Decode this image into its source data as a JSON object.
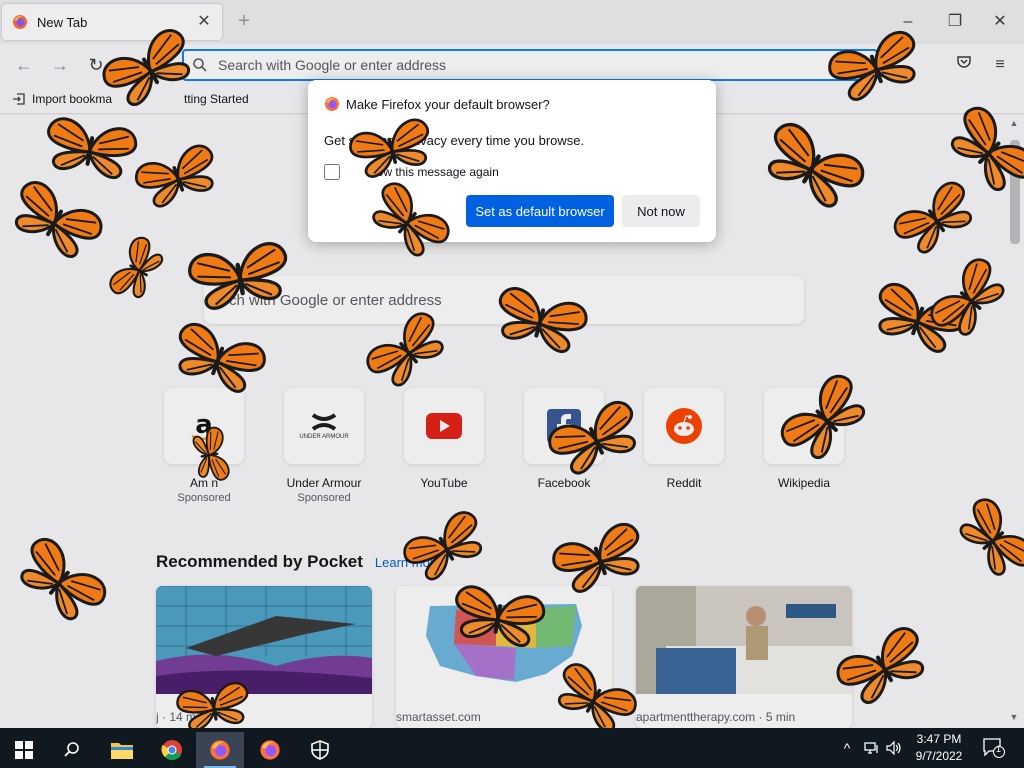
{
  "browser": {
    "tab_title": "New Tab",
    "tab_close": "✕",
    "new_tab": "+",
    "url_placeholder": "Search with Google or enter address",
    "bookmarks": [
      {
        "label": "Import bookma"
      },
      {
        "label": "tting Started"
      }
    ]
  },
  "content": {
    "search_placeholder": "rch with Google or enter address",
    "shortcuts": [
      {
        "label": "Am  n",
        "sponsored": "Sponsored"
      },
      {
        "label": "Under Armour",
        "sponsored": "Sponsored"
      },
      {
        "label": "YouTube"
      },
      {
        "label": "Facebook"
      },
      {
        "label": "Reddit"
      },
      {
        "label": "Wikipedia"
      }
    ],
    "pocket": {
      "heading": "Recommended by Pocket",
      "learn_more": "Learn more",
      "cards": [
        {
          "source": "j      · 14 min"
        },
        {
          "source": "smartasset.com"
        },
        {
          "source": "apartmenttherapy.com · 5 min"
        }
      ]
    },
    "ua_logo_text": "UNDER ARMOUR"
  },
  "modal": {
    "title": "Make Firefox your default browser?",
    "body": "Get  spee          and privacy every time you browse.",
    "checkbox_label": "how this message again",
    "primary_button": "Set as default browser",
    "secondary_button": "Not now"
  },
  "taskbar": {
    "time": "3:47 PM",
    "date": "9/7/2022",
    "notification_count": "1"
  },
  "colors": {
    "accent": "#0061e0",
    "focus_ring": "#0a84ff",
    "butterfly_orange": "#f07b14",
    "taskbar_bg": "#101820"
  }
}
